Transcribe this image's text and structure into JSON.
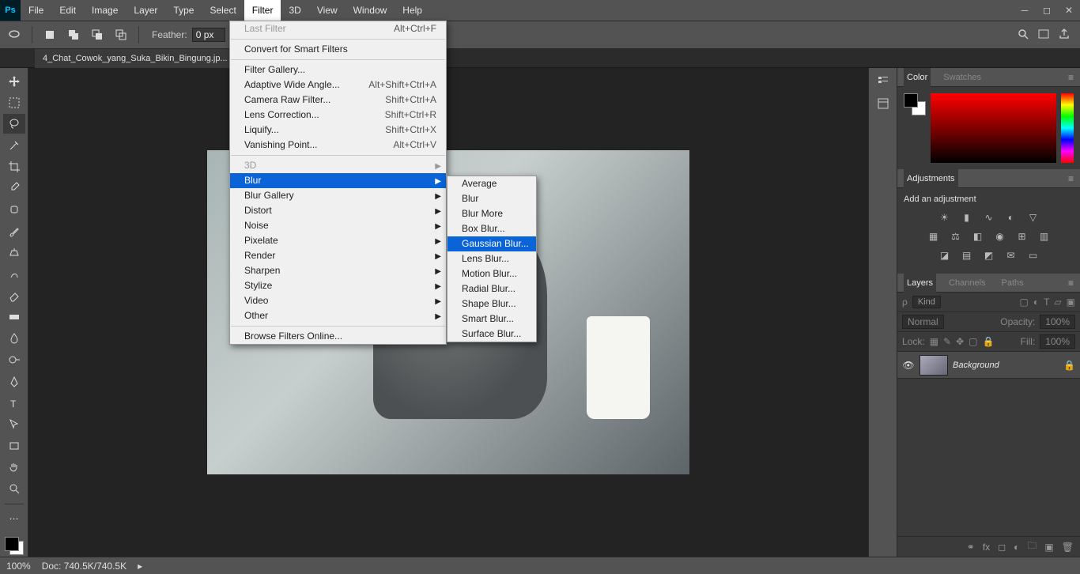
{
  "menu": [
    "File",
    "Edit",
    "Image",
    "Layer",
    "Type",
    "Select",
    "Filter",
    "3D",
    "View",
    "Window",
    "Help"
  ],
  "menu_open_index": 6,
  "options": {
    "feather_label": "Feather:",
    "feather_value": "0 px"
  },
  "doc_tab": "4_Chat_Cowok_yang_Suka_Bikin_Bingung.jp...",
  "filter_menu": {
    "last_filter": {
      "label": "Last Filter",
      "shortcut": "Alt+Ctrl+F",
      "disabled": true
    },
    "convert": {
      "label": "Convert for Smart Filters"
    },
    "gallery": {
      "label": "Filter Gallery..."
    },
    "adaptive": {
      "label": "Adaptive Wide Angle...",
      "shortcut": "Alt+Shift+Ctrl+A"
    },
    "cameraraw": {
      "label": "Camera Raw Filter...",
      "shortcut": "Shift+Ctrl+A"
    },
    "lens": {
      "label": "Lens Correction...",
      "shortcut": "Shift+Ctrl+R"
    },
    "liquify": {
      "label": "Liquify...",
      "shortcut": "Shift+Ctrl+X"
    },
    "vanish": {
      "label": "Vanishing Point...",
      "shortcut": "Alt+Ctrl+V"
    },
    "three_d": {
      "label": "3D",
      "disabled": true
    },
    "blur": {
      "label": "Blur"
    },
    "blur_gallery": {
      "label": "Blur Gallery"
    },
    "distort": {
      "label": "Distort"
    },
    "noise": {
      "label": "Noise"
    },
    "pixelate": {
      "label": "Pixelate"
    },
    "render": {
      "label": "Render"
    },
    "sharpen": {
      "label": "Sharpen"
    },
    "stylize": {
      "label": "Stylize"
    },
    "video": {
      "label": "Video"
    },
    "other": {
      "label": "Other"
    },
    "browse": {
      "label": "Browse Filters Online..."
    }
  },
  "blur_submenu": [
    "Average",
    "Blur",
    "Blur More",
    "Box Blur...",
    "Gaussian Blur...",
    "Lens Blur...",
    "Motion Blur...",
    "Radial Blur...",
    "Shape Blur...",
    "Smart Blur...",
    "Surface Blur..."
  ],
  "blur_hl_index": 4,
  "panels": {
    "color_tab": "Color",
    "swatches_tab": "Swatches",
    "adjust_tab": "Adjustments",
    "adjust_title": "Add an adjustment",
    "layers_tab": "Layers",
    "channels_tab": "Channels",
    "paths_tab": "Paths",
    "kind": "Kind",
    "normal": "Normal",
    "opacity_label": "Opacity:",
    "opacity": "100%",
    "lock_label": "Lock:",
    "fill_label": "Fill:",
    "fill": "100%",
    "layer_name": "Background"
  },
  "status": {
    "zoom": "100%",
    "doc": "Doc: 740.5K/740.5K"
  }
}
